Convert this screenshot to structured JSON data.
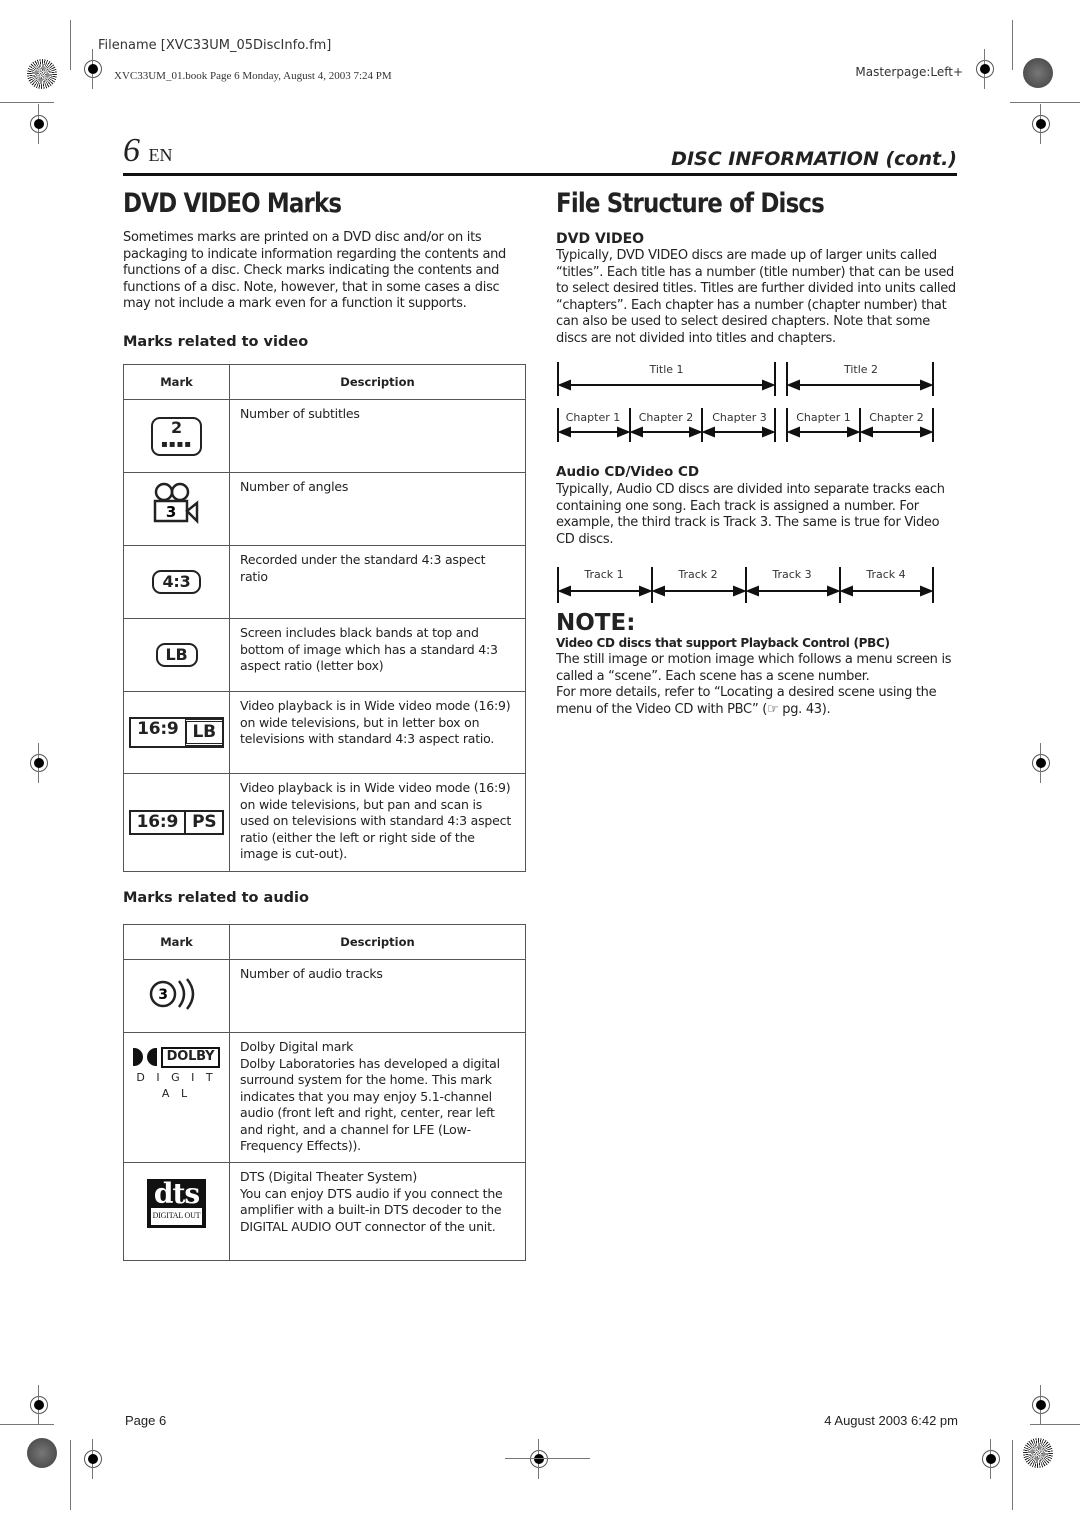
{
  "print_header": {
    "filename": "Filename [XVC33UM_05DiscInfo.fm]",
    "book_info": "XVC33UM_01.book  Page 6  Monday, August 4, 2003  7:24 PM",
    "masterpage": "Masterpage:Left+"
  },
  "page_header": {
    "page_number": "6",
    "lang": "EN",
    "section": "DISC INFORMATION (cont.)"
  },
  "left": {
    "title": "DVD VIDEO Marks",
    "intro": "Sometimes marks are printed on a DVD disc and/or on its packaging to indicate information regarding the contents and functions of a disc. Check marks indicating the contents and functions of a disc. Note, however, that in some cases a disc may not include a mark even for a function it supports.",
    "video_heading": "Marks related to video",
    "audio_heading": "Marks related to audio",
    "table_headers": {
      "mark": "Mark",
      "description": "Description"
    },
    "video_marks": [
      {
        "icon": "subtitles-icon",
        "glyph": "2",
        "description": "Number of subtitles"
      },
      {
        "icon": "angles-camera-icon",
        "glyph": "3",
        "description": "Number of angles"
      },
      {
        "icon": "aspect-4-3-icon",
        "glyph": "4:3",
        "description": "Recorded under the standard 4:3 aspect ratio"
      },
      {
        "icon": "letterbox-icon",
        "glyph": "LB",
        "description": "Screen includes black bands at top and bottom of image which has a standard 4:3 aspect ratio (letter box)"
      },
      {
        "icon": "wide-16-9-lb-icon",
        "glyph_a": "16:9",
        "glyph_b": "LB",
        "description": "Video playback is in Wide video mode (16:9) on wide televisions, but in letter box on televisions with standard 4:3 aspect ratio."
      },
      {
        "icon": "wide-16-9-ps-icon",
        "glyph_a": "16:9",
        "glyph_b": "PS",
        "description": "Video playback is in Wide video mode (16:9) on wide televisions, but pan and scan is used on televisions with standard 4:3 aspect ratio (either the left or right side of the image is cut-out)."
      }
    ],
    "audio_marks": [
      {
        "icon": "audio-tracks-icon",
        "glyph": "3",
        "description": "Number of audio tracks"
      },
      {
        "icon": "dolby-digital-logo",
        "glyph_a": "DOLBY",
        "glyph_b": "D I G I T A L",
        "description_title": "Dolby Digital mark",
        "description": "Dolby Laboratories has developed a digital surround system for the home. This mark indicates that you may enjoy 5.1-channel audio (front left and right, center, rear left and right, and a channel for LFE (Low-Frequency Effects))."
      },
      {
        "icon": "dts-logo",
        "glyph_a": "dts",
        "glyph_b": "DIGITAL OUT",
        "description_title": "DTS (Digital Theater System)",
        "description": "You can enjoy DTS audio if you connect the amplifier with a built-in DTS decoder to the DIGITAL AUDIO OUT connector of the unit."
      }
    ]
  },
  "right": {
    "title": "File Structure of Discs",
    "dvd_heading": "DVD VIDEO",
    "dvd_text": "Typically, DVD VIDEO discs are made up of larger units called “titles”. Each title has a number (title number) that can be used to select desired titles. Titles are further divided into units called “chapters”. Each chapter has a number (chapter number) that can also be used to select desired chapters. Note that some discs are not divided into titles and chapters.",
    "titles": [
      "Title 1",
      "Title 2"
    ],
    "chapters": [
      "Chapter 1",
      "Chapter 2",
      "Chapter 3",
      "Chapter 1",
      "Chapter 2"
    ],
    "cd_heading": "Audio CD/Video CD",
    "cd_text": "Typically, Audio CD discs are divided into separate tracks each containing one song. Each track is assigned a number. For example, the third track is Track 3. The same is true for Video CD discs.",
    "tracks": [
      "Track 1",
      "Track 2",
      "Track 3",
      "Track 4"
    ],
    "note_title": "NOTE:",
    "note_heading": "Video CD discs that support Playback Control (PBC)",
    "note_text_1": "The still image or motion image which follows a menu screen is called a “scene”. Each scene has a scene number.",
    "note_text_2": "For more details, refer to “Locating a desired scene using the menu of the Video CD with PBC” (☞ pg. 43)."
  },
  "footer": {
    "page": "Page 6",
    "date": "4 August 2003 6:42 pm"
  }
}
